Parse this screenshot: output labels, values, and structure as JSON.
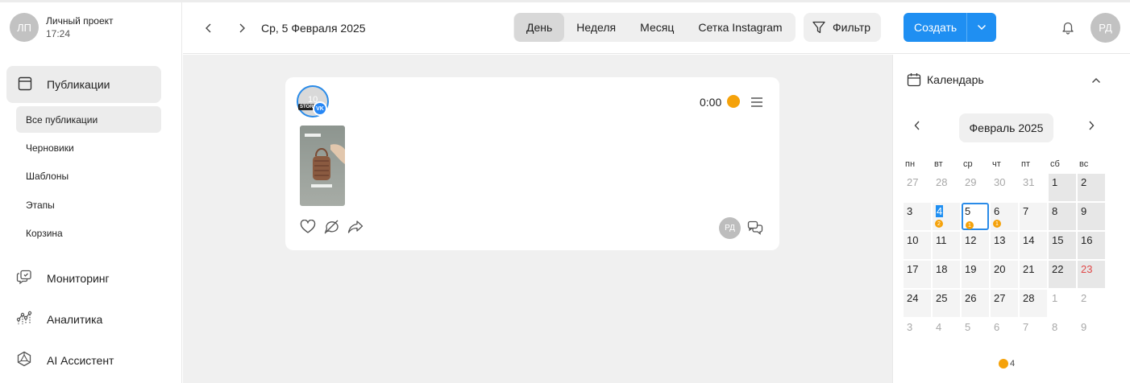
{
  "sidebar": {
    "project": {
      "avatar": "ЛП",
      "name": "Личный проект",
      "time": "17:24"
    },
    "main_item": {
      "label": "Публикации",
      "icon": "panel-icon"
    },
    "sub_items": [
      {
        "label": "Все публикации"
      },
      {
        "label": "Черновики"
      },
      {
        "label": "Шаблоны"
      },
      {
        "label": "Этапы"
      },
      {
        "label": "Корзина"
      }
    ],
    "nav_items": [
      {
        "label": "Мониторинг",
        "icon": "monitoring-icon"
      },
      {
        "label": "Аналитика",
        "icon": "analytics-icon"
      },
      {
        "label": "AI Ассистент",
        "icon": "ai-icon"
      }
    ]
  },
  "header": {
    "date": "Ср, 5 Февраля 2025",
    "views": [
      "День",
      "Неделя",
      "Месяц",
      "Сетка Instagram"
    ],
    "active_view": "День",
    "filter_label": "Фильтр",
    "create_label": "Создать",
    "user_avatar": "РД",
    "accent": "#1f8ff2"
  },
  "post": {
    "account_number": "10",
    "story_badge": "STORY",
    "network_badge": "VK",
    "time": "0:00",
    "status_color": "#f5a20a",
    "author_avatar": "РД",
    "actions": [
      "like-icon",
      "comment-off-icon",
      "share-icon"
    ]
  },
  "calendar": {
    "title": "Календарь",
    "month": "Февраль 2025",
    "weekdays": [
      "пн",
      "вт",
      "ср",
      "чт",
      "пт",
      "сб",
      "вс"
    ],
    "weeks": [
      [
        "27",
        "28",
        "29",
        "30",
        "31",
        "1",
        "2"
      ],
      [
        "3",
        "4",
        "5",
        "6",
        "7",
        "8",
        "9"
      ],
      [
        "10",
        "11",
        "12",
        "13",
        "14",
        "15",
        "16"
      ],
      [
        "17",
        "18",
        "19",
        "20",
        "21",
        "22",
        "23"
      ],
      [
        "24",
        "25",
        "26",
        "27",
        "28",
        "1",
        "2"
      ],
      [
        "3",
        "4",
        "5",
        "6",
        "7",
        "8",
        "9"
      ]
    ],
    "badges": {
      "4": "2",
      "5": "1",
      "6": "1"
    },
    "legend_count": "4"
  }
}
